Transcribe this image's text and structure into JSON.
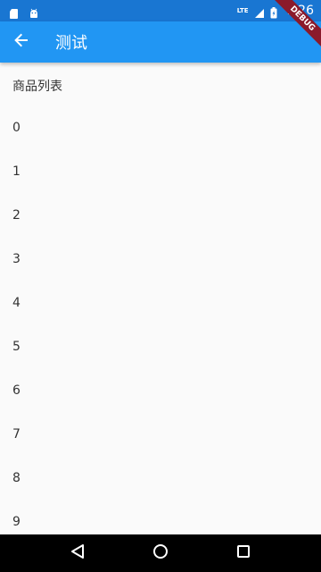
{
  "status_bar": {
    "time": "7:26",
    "network_label": "LTE",
    "left_icons": [
      "sd-card-icon",
      "android-icon"
    ],
    "colors": {
      "background": "#1976d2"
    }
  },
  "app_bar": {
    "title": "测试",
    "back_icon": "arrow-left-icon",
    "colors": {
      "background": "#2196f3"
    }
  },
  "debug_banner": {
    "label": "DEBUG",
    "color": "#8b1a2b"
  },
  "content": {
    "header": "商品列表",
    "items": [
      "0",
      "1",
      "2",
      "3",
      "4",
      "5",
      "6",
      "7",
      "8",
      "9"
    ]
  },
  "nav_bar": {
    "buttons": [
      "back-triangle-icon",
      "home-circle-icon",
      "recents-square-icon"
    ]
  }
}
